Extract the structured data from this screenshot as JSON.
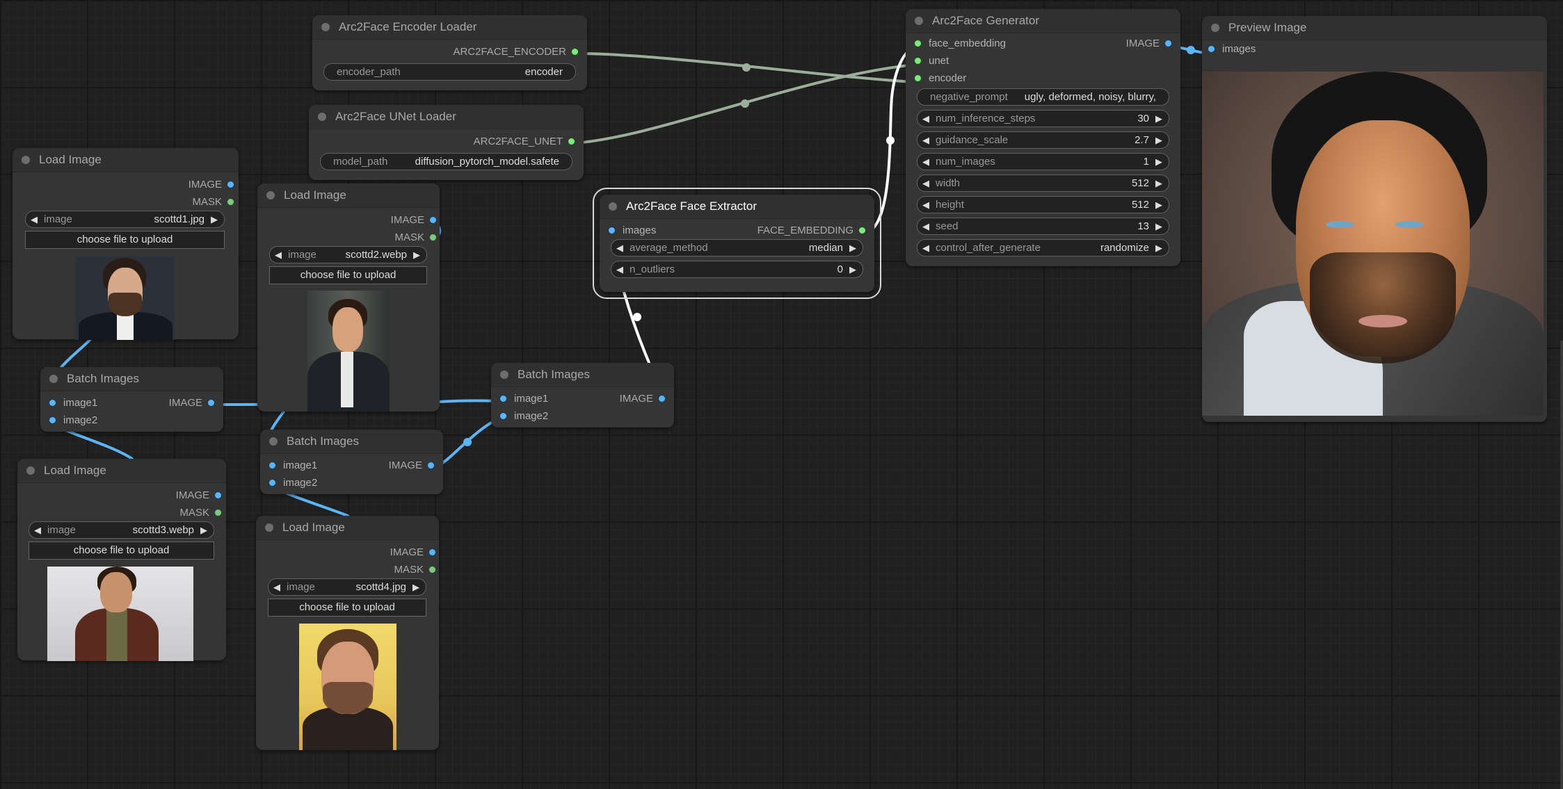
{
  "canvas": {
    "link_colors": {
      "image": "#5db5f6",
      "model": "#9aae9a",
      "embedding": "#ffffff"
    }
  },
  "nodes": {
    "encoder_loader": {
      "title": "Arc2Face Encoder Loader",
      "outputs": [
        "ARC2FACE_ENCODER"
      ],
      "widgets": [
        {
          "label": "encoder_path",
          "value": "encoder"
        }
      ]
    },
    "unet_loader": {
      "title": "Arc2Face UNet Loader",
      "outputs": [
        "ARC2FACE_UNET"
      ],
      "widgets": [
        {
          "label": "model_path",
          "value": "diffusion_pytorch_model.safete"
        }
      ]
    },
    "generator": {
      "title": "Arc2Face Generator",
      "inputs": [
        "face_embedding",
        "unet",
        "encoder"
      ],
      "outputs": [
        "IMAGE"
      ],
      "widgets": [
        {
          "label": "negative_prompt",
          "value": "ugly, deformed, noisy, blurry,"
        },
        {
          "label": "num_inference_steps",
          "value": "30"
        },
        {
          "label": "guidance_scale",
          "value": "2.7"
        },
        {
          "label": "num_images",
          "value": "1"
        },
        {
          "label": "width",
          "value": "512"
        },
        {
          "label": "height",
          "value": "512"
        },
        {
          "label": "seed",
          "value": "13"
        },
        {
          "label": "control_after_generate",
          "value": "randomize"
        }
      ]
    },
    "preview": {
      "title": "Preview Image",
      "inputs": [
        "images"
      ],
      "image_alt": "generated portrait of bearded man"
    },
    "face_extractor": {
      "title": "Arc2Face Face Extractor",
      "inputs": [
        "images"
      ],
      "outputs": [
        "FACE_EMBEDDING"
      ],
      "widgets": [
        {
          "label": "average_method",
          "value": "median"
        },
        {
          "label": "n_outliers",
          "value": "0"
        }
      ]
    },
    "load1": {
      "title": "Load Image",
      "outputs": [
        "IMAGE",
        "MASK"
      ],
      "widget": {
        "label": "image",
        "value": "scottd1.jpg"
      },
      "upload_label": "choose file to upload"
    },
    "load2": {
      "title": "Load Image",
      "outputs": [
        "IMAGE",
        "MASK"
      ],
      "widget": {
        "label": "image",
        "value": "scottd2.webp"
      },
      "upload_label": "choose file to upload"
    },
    "load3": {
      "title": "Load Image",
      "outputs": [
        "IMAGE",
        "MASK"
      ],
      "widget": {
        "label": "image",
        "value": "scottd3.webp"
      },
      "upload_label": "choose file to upload"
    },
    "load4": {
      "title": "Load Image",
      "outputs": [
        "IMAGE",
        "MASK"
      ],
      "widget": {
        "label": "image",
        "value": "scottd4.jpg"
      },
      "upload_label": "choose file to upload"
    },
    "batch1": {
      "title": "Batch Images",
      "inputs": [
        "image1",
        "image2"
      ],
      "outputs": [
        "IMAGE"
      ]
    },
    "batch2": {
      "title": "Batch Images",
      "inputs": [
        "image1",
        "image2"
      ],
      "outputs": [
        "IMAGE"
      ]
    },
    "batch3": {
      "title": "Batch Images",
      "inputs": [
        "image1",
        "image2"
      ],
      "outputs": [
        "IMAGE"
      ]
    }
  }
}
